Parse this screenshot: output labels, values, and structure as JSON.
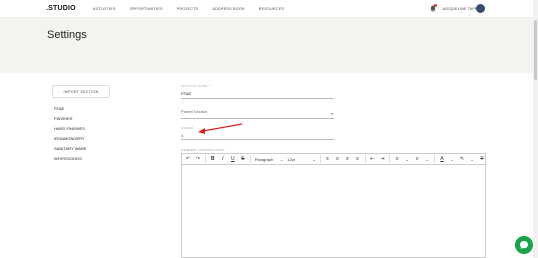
{
  "app": {
    "logo": ".STUDIO"
  },
  "nav": {
    "items": [
      "ACTIVITIES",
      "OPPORTUNITIES",
      "PROJECTS",
      "ADDRESS BOOK",
      "RESOURCES"
    ]
  },
  "user": {
    "name": "JACQUELINE TAPP"
  },
  "page": {
    "title": "Settings"
  },
  "import": {
    "label": "IMPORT SECTION"
  },
  "sections": [
    "FF&E",
    "FINISHES",
    "HARD FINISHES",
    "IRONMONGERY",
    "SANITARY WARE",
    "WHITEGOODS"
  ],
  "form": {
    "section_name_label": "SECTION NAME *",
    "section_name_value": "FF&E",
    "parent_placeholder": "Parent Section",
    "order_label": "ORDER",
    "order_value": "1",
    "instructions_label": "GENERAL INSTRUCTIONS"
  },
  "editor": {
    "paragraph_label": "Paragraph",
    "font_size_label": "12pt"
  }
}
